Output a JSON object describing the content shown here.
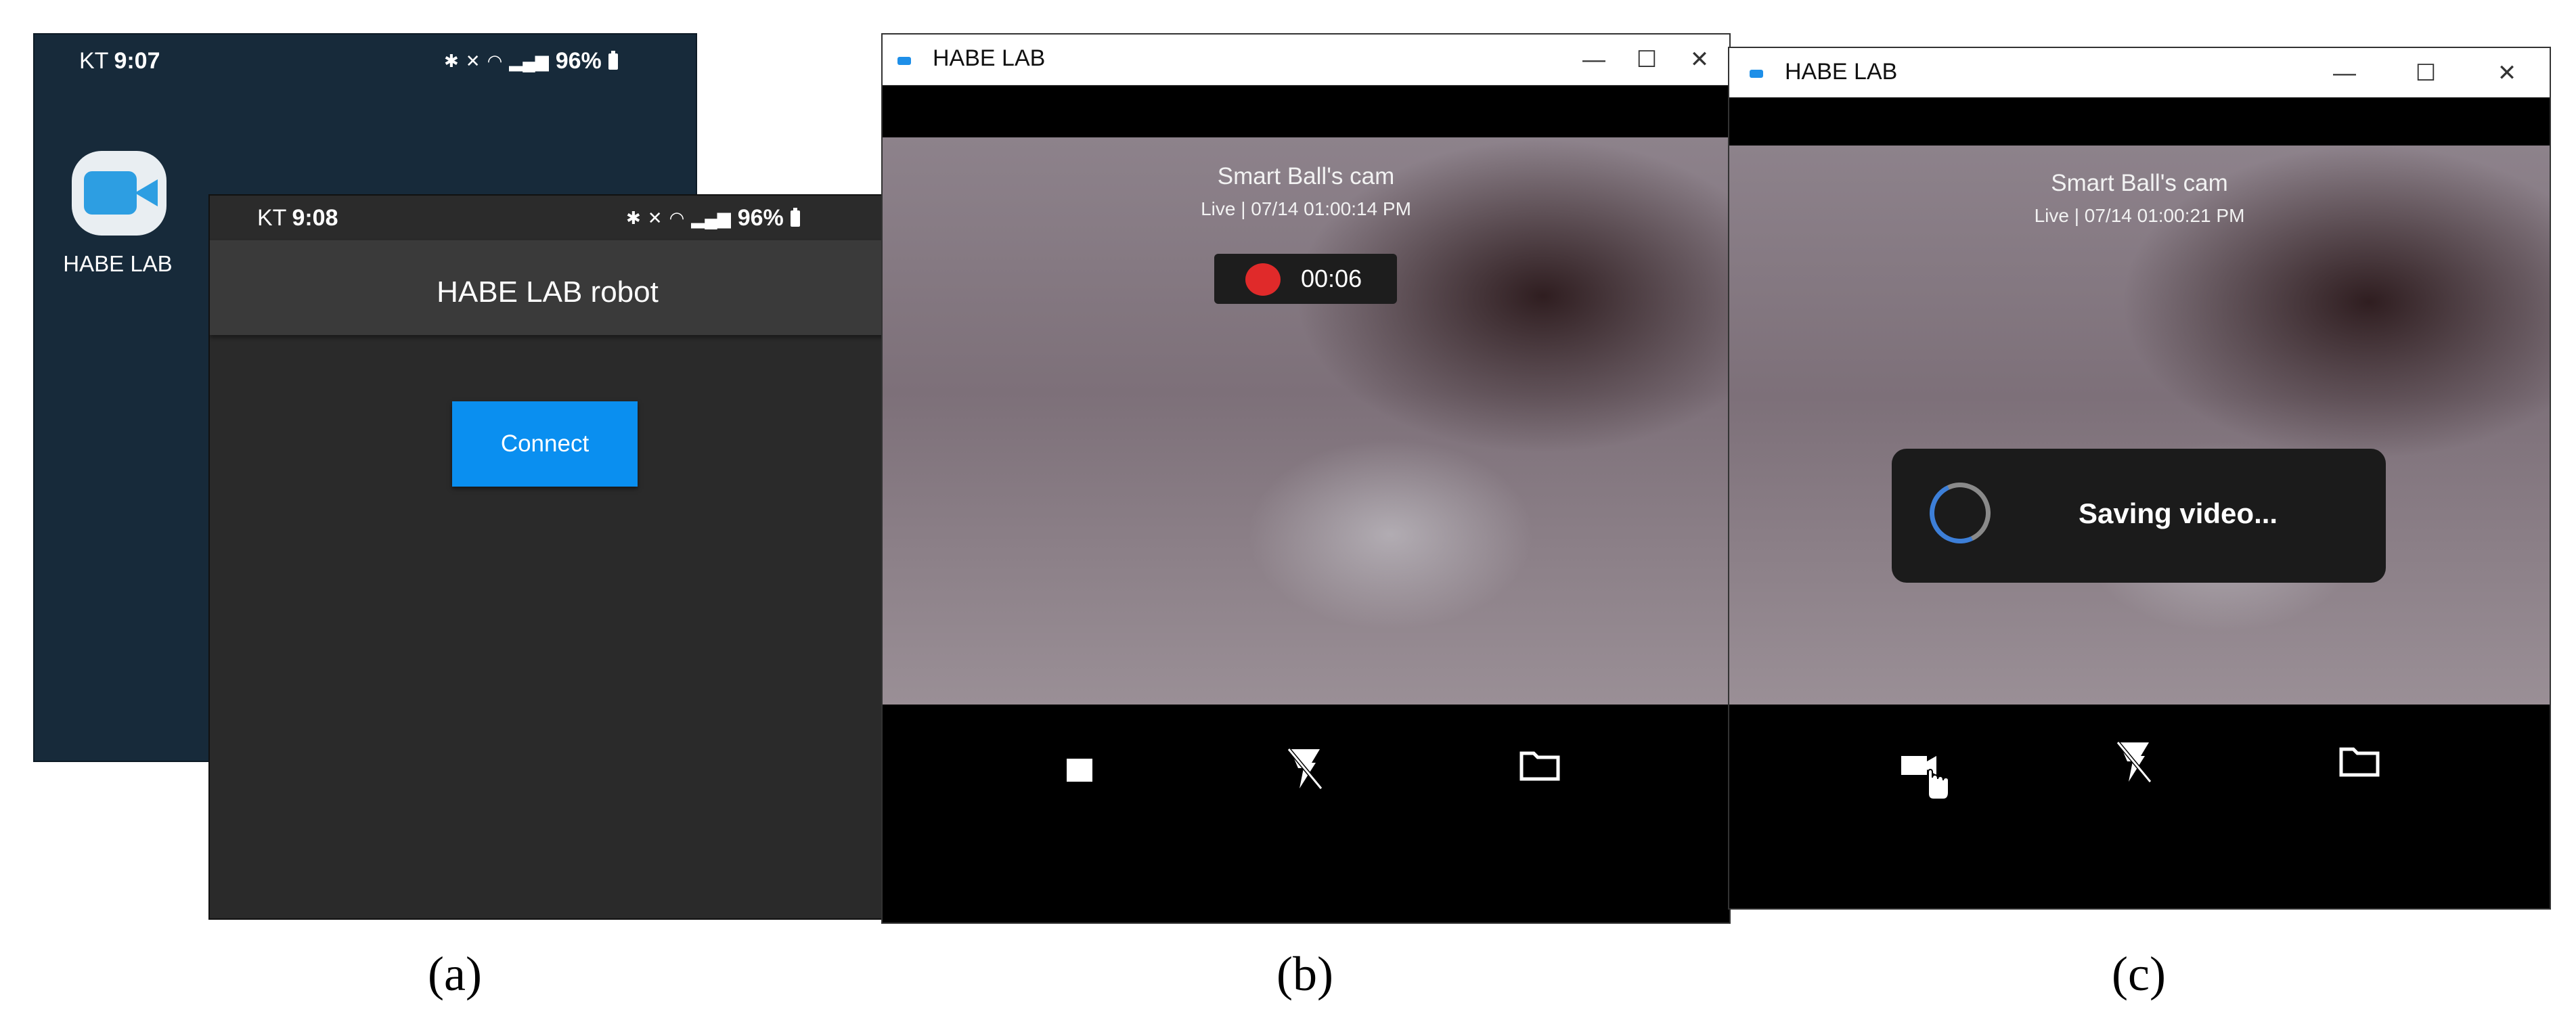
{
  "panel_a": {
    "home": {
      "carrier": "KT",
      "time": "9:07",
      "battery": "96%",
      "app_icon": "video-camera-icon",
      "app_label": "HABE LAB"
    },
    "app": {
      "carrier": "KT",
      "time": "9:08",
      "battery": "96%",
      "title": "HABE LAB robot",
      "connect_label": "Connect",
      "accent_color": "#0a8ff0"
    }
  },
  "panel_b": {
    "window_title": "HABE LAB",
    "cam_title": "Smart Ball's cam",
    "cam_status": "Live | 07/14 01:00:14 PM",
    "recording_time": "00:06",
    "controls": [
      "stop-icon",
      "flash-off-icon",
      "folder-icon"
    ]
  },
  "panel_c": {
    "window_title": "HABE LAB",
    "cam_title": "Smart Ball's cam",
    "cam_status": "Live | 07/14 01:00:21 PM",
    "saving_text": "Saving video...",
    "controls": [
      "record-icon",
      "flash-off-icon",
      "folder-icon"
    ]
  },
  "captions": {
    "a": "(a)",
    "b": "(b)",
    "c": "(c)"
  },
  "colors": {
    "home_bg": "#172a3a",
    "app_bg": "#2a2a2a",
    "record_red": "#e02a2a",
    "window_accent": "#1e8fe8"
  }
}
